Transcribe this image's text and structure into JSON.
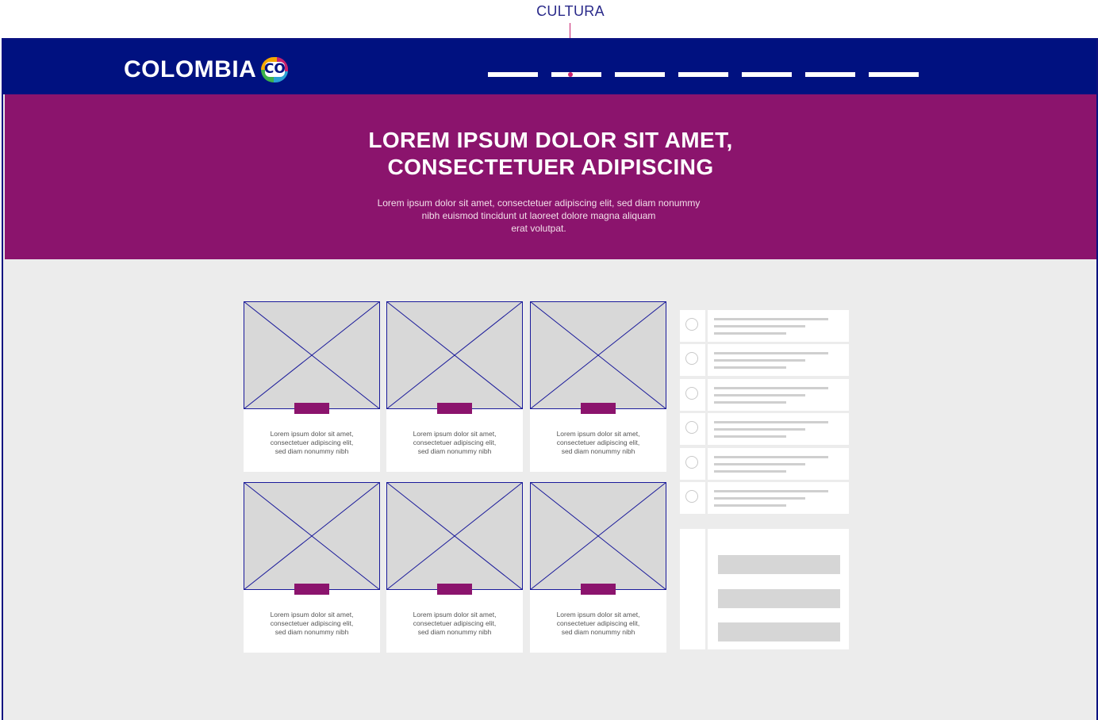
{
  "annotation": {
    "label": "CULTURA",
    "accent_color": "#c8216f"
  },
  "header": {
    "logo_text": "COLOMBIA",
    "logo_badge_text": "CO",
    "background_color": "#001180",
    "nav_items": [
      {
        "name": "nav-item-1"
      },
      {
        "name": "nav-item-2-cultura"
      },
      {
        "name": "nav-item-3"
      },
      {
        "name": "nav-item-4"
      },
      {
        "name": "nav-item-5"
      },
      {
        "name": "nav-item-6"
      },
      {
        "name": "nav-item-7"
      }
    ]
  },
  "hero": {
    "background_color": "#8b146d",
    "title_line1": "LOREM IPSUM DOLOR SIT AMET,",
    "title_line2": "CONSECTETUER ADIPISCING",
    "text_line1": "Lorem ipsum dolor sit amet, consectetuer adipiscing elit, sed diam nonummy",
    "text_line2": "nibh euismod tincidunt ut laoreet dolore magna aliquam",
    "text_line3": "erat volutpat."
  },
  "cards": [
    {
      "line1": "Lorem ipsum dolor sit amet,",
      "line2": "consectetuer adipiscing elit,",
      "line3": "sed diam nonummy nibh"
    },
    {
      "line1": "Lorem ipsum dolor sit amet,",
      "line2": "consectetuer adipiscing elit,",
      "line3": "sed diam nonummy nibh"
    },
    {
      "line1": "Lorem ipsum dolor sit amet,",
      "line2": "consectetuer adipiscing elit,",
      "line3": "sed diam nonummy nibh"
    },
    {
      "line1": "Lorem ipsum dolor sit amet,",
      "line2": "consectetuer adipiscing elit,",
      "line3": "sed diam nonummy nibh"
    },
    {
      "line1": "Lorem ipsum dolor sit amet,",
      "line2": "consectetuer adipiscing elit,",
      "line3": "sed diam nonummy nibh"
    },
    {
      "line1": "Lorem ipsum dolor sit amet,",
      "line2": "consectetuer adipiscing elit,",
      "line3": "sed diam nonummy nibh"
    }
  ],
  "sidebar": {
    "list_item_count_shown": 6,
    "form_field_count_shown": 3,
    "placeholder_color": "#d6d6d6"
  },
  "colors": {
    "brand_blue": "#001180",
    "brand_magenta": "#8b146d",
    "page_background": "#ececec",
    "wireframe_line": "#1a1a9a"
  }
}
